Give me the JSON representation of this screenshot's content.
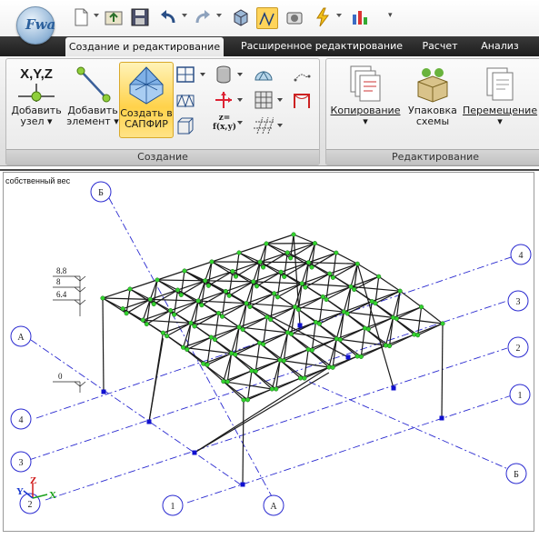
{
  "app": {
    "logo_text": "Fwa"
  },
  "quick_access": {
    "items": [
      "new-document",
      "open",
      "save",
      "undo",
      "redo",
      "3d-view",
      "structure-view",
      "camera",
      "lightning",
      "chart"
    ]
  },
  "tabs": [
    {
      "label": "Создание и редактирование",
      "active": true
    },
    {
      "label": "Расширенное редактирование",
      "active": false
    },
    {
      "label": "Расчет",
      "active": false
    },
    {
      "label": "Анализ",
      "active": false
    }
  ],
  "ribbon": {
    "create_group": {
      "label": "Создание",
      "add_node": {
        "icon_text": "X,Y,Z",
        "line1": "Добавить",
        "line2": "узел"
      },
      "add_element": {
        "line1": "Добавить",
        "line2": "элемент"
      },
      "create_sapfir": {
        "line1": "Создать в",
        "line2": "САПФИР"
      },
      "function_label": {
        "top": "z=",
        "bottom": "f(x,y)"
      }
    },
    "edit_group": {
      "label": "Редактирование",
      "copy": {
        "line1": "Копирование"
      },
      "pack": {
        "line1": "Упаковка",
        "line2": "схемы"
      },
      "move": {
        "line1": "Перемещение"
      }
    }
  },
  "canvas": {
    "load_case": "собственный вес",
    "levels": [
      "8.8",
      "8",
      "6.4",
      "0"
    ],
    "axis_labels": [
      "Б",
      "4",
      "3",
      "2",
      "1",
      "Б",
      "А",
      "4",
      "3",
      "А",
      "1",
      "2"
    ],
    "axes_triad": {
      "x": "X",
      "y": "Y",
      "z": "Z"
    },
    "colors": {
      "node": "#32d22e",
      "support": "#1010d0",
      "axis_line": "#2a2ad0",
      "member": "#1a1a1a"
    }
  }
}
